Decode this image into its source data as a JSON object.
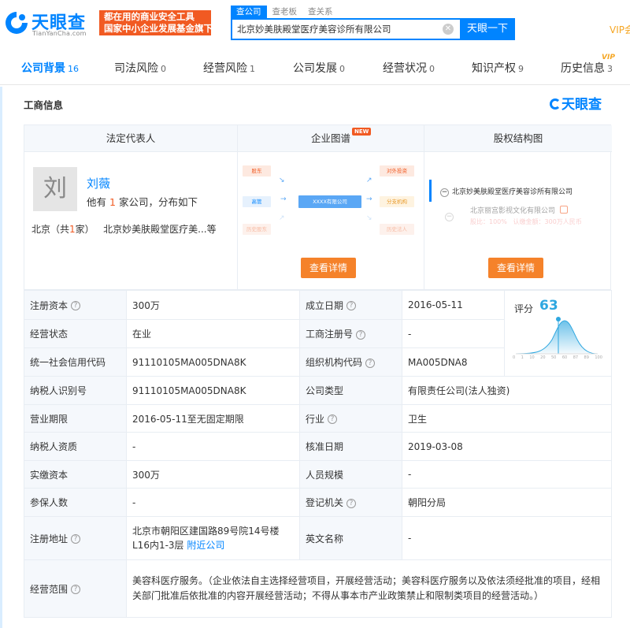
{
  "header": {
    "logo_name": "天眼查",
    "logo_sub": "TianYanCha.com",
    "slogan_line1": "都在用的商业安全工具",
    "slogan_line2": "国家中小企业发展基金旗下",
    "search_tabs": [
      "查公司",
      "查老板",
      "查关系"
    ],
    "search_value": "北京妙美肤殿堂医疗美容诊所有限公司",
    "search_button": "天眼一下",
    "vip_link": "VIP会"
  },
  "nav": [
    {
      "label": "公司背景",
      "count": "16",
      "active": true
    },
    {
      "label": "司法风险",
      "count": "0"
    },
    {
      "label": "经营风险",
      "count": "1"
    },
    {
      "label": "公司发展",
      "count": "0"
    },
    {
      "label": "经营状况",
      "count": "0"
    },
    {
      "label": "知识产权",
      "count": "9"
    },
    {
      "label": "历史信息",
      "count": "3"
    }
  ],
  "nav_vip": "VIP",
  "section": {
    "title": "工商信息",
    "brand": "天眼查"
  },
  "legal": {
    "head": "法定代表人",
    "avatar": "刘",
    "name": "刘薇",
    "desc_pre": "他有",
    "desc_num": "1",
    "desc_post": "家公司，分布如下",
    "region_pre": "北京（共",
    "region_num": "1",
    "region_post": "家）",
    "region_company": "北京妙美肤殿堂医疗美...等"
  },
  "graph": {
    "head": "企业图谱",
    "new_badge": "NEW",
    "center": "XXXX有限公司",
    "left_nodes": [
      "股东",
      "高管",
      "历史股东"
    ],
    "right_nodes": [
      "对外投资",
      "分支机构",
      "历史法人"
    ],
    "button": "查看详情"
  },
  "equity": {
    "head": "股权结构图",
    "company": "北京妙美肤殿堂医疗美容诊所有限公司",
    "child": "北京丽宫影视文化有限公司",
    "child_ratio": "股比：100%",
    "child_amount": "认缴金额：300万人民币",
    "button": "查看详情"
  },
  "score": {
    "label": "评分",
    "value": "63",
    "ticks": [
      "0",
      "1",
      "10",
      "20",
      "50",
      "60",
      "87",
      "89",
      "100"
    ],
    "color": "#2ea7e0"
  },
  "rows": {
    "reg_capital": {
      "label": "注册资本",
      "value": "300万"
    },
    "founded": {
      "label": "成立日期",
      "value": "2016-05-11"
    },
    "status": {
      "label": "经营状态",
      "value": "在业"
    },
    "reg_no": {
      "label": "工商注册号",
      "value": "-"
    },
    "credit_code": {
      "label": "统一社会信用代码",
      "value": "91110105MA005DNA8K"
    },
    "org_code": {
      "label": "组织机构代码",
      "value": "MA005DNA8"
    },
    "taxpayer_id": {
      "label": "纳税人识别号",
      "value": "91110105MA005DNA8K"
    },
    "company_type": {
      "label": "公司类型",
      "value": "有限责任公司(法人独资)"
    },
    "term": {
      "label": "营业期限",
      "value": "2016-05-11至无固定期限"
    },
    "industry": {
      "label": "行业",
      "value": "卫生"
    },
    "taxpayer_qual": {
      "label": "纳税人资质",
      "value": "-"
    },
    "approval_date": {
      "label": "核准日期",
      "value": "2019-03-08"
    },
    "paid_capital": {
      "label": "实缴资本",
      "value": "300万"
    },
    "staff_size": {
      "label": "人员规模",
      "value": "-"
    },
    "insured": {
      "label": "参保人数",
      "value": "-"
    },
    "authority": {
      "label": "登记机关",
      "value": "朝阳分局"
    },
    "address": {
      "label": "注册地址",
      "line1": "北京市朝阳区建国路89号院14号楼",
      "line2": "L16内1-3层",
      "nearby": "附近公司"
    },
    "english_name": {
      "label": "英文名称",
      "value": "-"
    },
    "scope": {
      "label": "经营范围",
      "value": "美容科医疗服务。（企业依法自主选择经营项目，开展经营活动；美容科医疗服务以及依法须经批准的项目，经相关部门批准后依批准的内容开展经营活动；不得从事本市产业政策禁止和限制类项目的经营活动。）"
    }
  }
}
